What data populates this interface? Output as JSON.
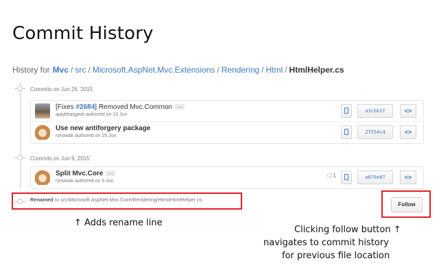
{
  "page": {
    "title": "Commit History"
  },
  "breadcrumb": {
    "prefix": "History for",
    "repo": "Mvc",
    "parts": [
      "src",
      "Microsoft.AspNet.Mvc.Extensions",
      "Rendering",
      "Html"
    ],
    "separator": "/",
    "file": "HtmlHelper.cs"
  },
  "groups": [
    {
      "title": "Commits on Jun 26, 2015",
      "commits": [
        {
          "issue_prefix": "[Fixes ",
          "issue_link": "#2684",
          "message": "] Removed Mvc.Common",
          "ellipsis": "…",
          "meta": "ajaybhargavb authored on 13 Jun",
          "sha": "a3cbb1f",
          "browse": "<>",
          "avatar": "person"
        },
        {
          "message": "Use new antiforgery package",
          "meta": "rynowak authored on 25 Jun",
          "sha": "2f554c4",
          "browse": "<>",
          "avatar": "dog"
        }
      ]
    },
    {
      "title": "Commits on Jun 9, 2015",
      "commits": [
        {
          "message": "Split Mvc.Core",
          "ellipsis": "…",
          "meta": "rynowak authored on 5 Jun",
          "comment_count": "1",
          "sha": "a679e87",
          "browse": "<>",
          "avatar": "dog"
        }
      ]
    }
  ],
  "rename": {
    "label": "Renamed",
    "text": "to src/Microsoft.AspNet.Mvc.Core/Rendering/Html/HtmlHelper.cs"
  },
  "follow_button": {
    "label": "Follow"
  },
  "annotations": {
    "rename_note": "↑ Adds rename line",
    "follow_note_line1": "Clicking follow button ↑",
    "follow_note_line2": "navigates to commit history",
    "follow_note_line3": "for previous file location",
    "highlight_color": "#e02020"
  },
  "colors": {
    "link": "#4078c0",
    "muted": "#767676"
  },
  "icons": {
    "copy": "clipboard-icon",
    "comment": "comment-icon",
    "timeline": "commit-dot-icon"
  }
}
